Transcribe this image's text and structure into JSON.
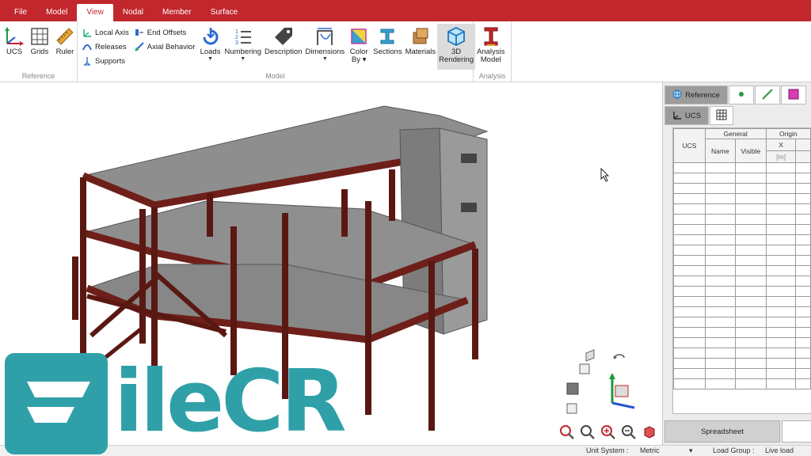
{
  "tabs": [
    {
      "label": "File",
      "active": false
    },
    {
      "label": "Model",
      "active": false
    },
    {
      "label": "View",
      "active": true
    },
    {
      "label": "Nodal",
      "active": false
    },
    {
      "label": "Member",
      "active": false
    },
    {
      "label": "Surface",
      "active": false
    }
  ],
  "ribbon": {
    "reference": {
      "group_label": "Reference",
      "ucs": "UCS",
      "grids": "Grids",
      "ruler": "Ruler"
    },
    "model": {
      "group_label": "Model",
      "local_axis": "Local Axis",
      "releases": "Releases",
      "supports": "Supports",
      "end_offsets": "End Offsets",
      "axial_behavior": "Axial Behavior",
      "loads": "Loads",
      "numbering": "Numbering",
      "description": "Description",
      "dimensions": "Dimensions",
      "color_by_1": "Color",
      "color_by_2": "By",
      "sections": "Sections",
      "materials": "Materials",
      "rendering_1": "3D",
      "rendering_2": "Rendering"
    },
    "analysis": {
      "group_label": "Analysis",
      "model_1": "Analysis",
      "model_2": "Model"
    }
  },
  "right_panel": {
    "tab_reference": "Reference",
    "tab_ucs": "UCS",
    "table": {
      "col_ucs": "UCS",
      "group_general": "General",
      "group_origin": "Origin",
      "col_name": "Name",
      "col_visible": "Visible",
      "col_x": "X",
      "col_x_unit": "[m]"
    },
    "spreadsheet_button": "Spreadsheet"
  },
  "status": {
    "unit_system_label": "Unit System :",
    "unit_system_value": "Metric",
    "load_group_label": "Load Group :",
    "load_group_value": "Live load"
  },
  "watermark": {
    "text": "ileCR"
  },
  "colors": {
    "brand_red": "#c1272d",
    "beam_red": "#7a2a24",
    "slab_gray": "#8e8e8e",
    "watermark_teal": "#2fa0a8"
  }
}
